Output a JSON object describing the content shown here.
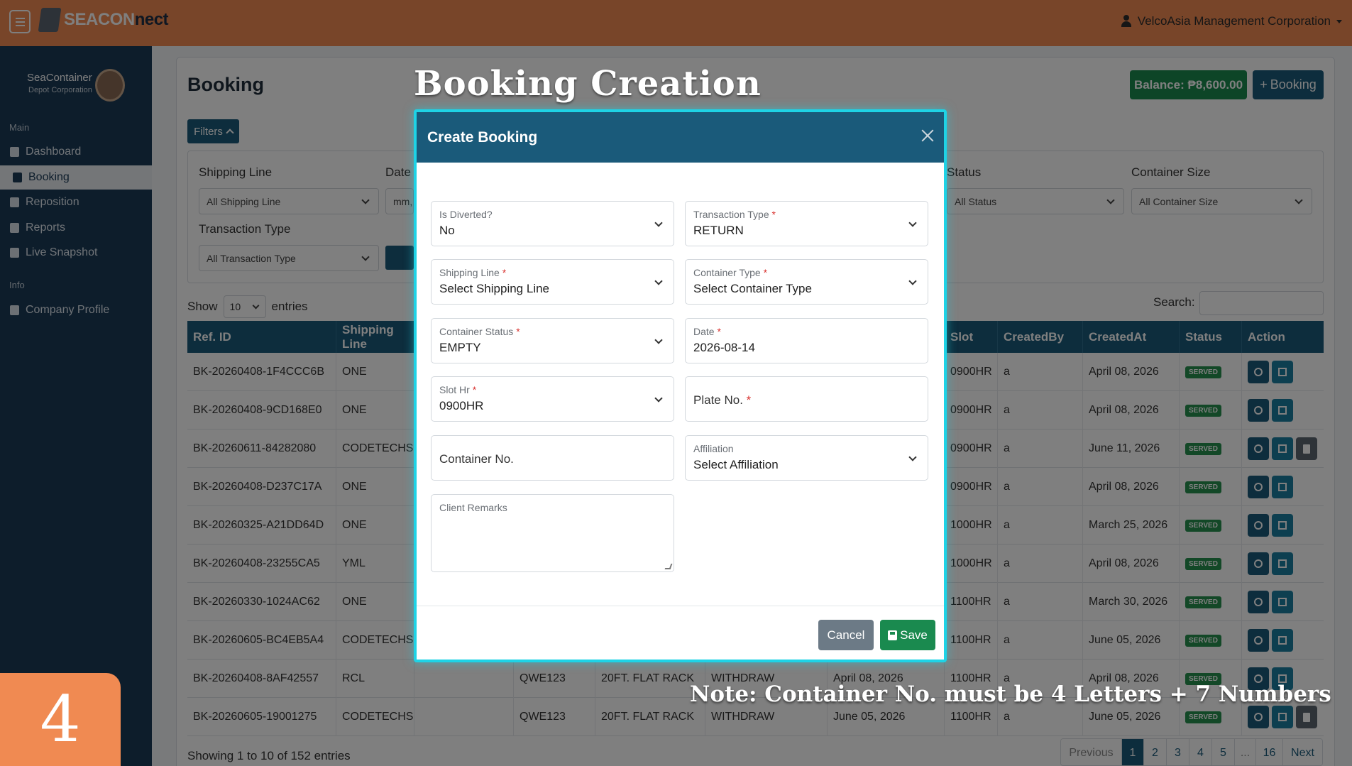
{
  "topbar": {
    "logo_text_a": "SEACON",
    "logo_text_b": "nect",
    "user_name": "VelcoAsia Management Corporation"
  },
  "sidebar": {
    "brand_name": "SeaContainer",
    "brand_sub": "Depot Corporation",
    "section_main": "Main",
    "section_info": "Info",
    "items": [
      {
        "label": "Dashboard",
        "icon": "bar-chart-icon"
      },
      {
        "label": "Booking",
        "icon": "list-icon"
      },
      {
        "label": "Reposition",
        "icon": "reposition-icon"
      },
      {
        "label": "Reports",
        "icon": "report-icon"
      },
      {
        "label": "Live Snapshot",
        "icon": "camera-icon"
      },
      {
        "label": "Company Profile",
        "icon": "user-icon"
      }
    ]
  },
  "page": {
    "title": "Booking",
    "balance": "Balance: ₱8,600.00",
    "new_booking": "Booking",
    "filters_btn": "Filters"
  },
  "filters": {
    "shipping_line_label": "Shipping Line",
    "shipping_line_value": "All Shipping Line",
    "date_label": "Date",
    "date_value": "mm,",
    "transaction_type_label": "Transaction Type",
    "transaction_type_value": "All Transaction Type",
    "status_label": "Status",
    "status_value": "All Status",
    "container_size_label": "Container Size",
    "container_size_value": "All Container Size"
  },
  "table_controls": {
    "show": "Show",
    "entries_value": "10",
    "entries": "entries",
    "search_label": "Search:"
  },
  "table": {
    "headers": [
      "Ref. ID",
      "Shipping Line",
      "Slot",
      "CreatedBy",
      "CreatedAt",
      "Status",
      "Action"
    ],
    "rows": [
      {
        "ref": "BK-20260408-1F4CCC6B",
        "line": "ONE",
        "plate": "",
        "size": "",
        "type": "",
        "date": "",
        "slot": "0900HR",
        "by": "a",
        "at": "April 08, 2026",
        "status": "SERVED",
        "doc": false
      },
      {
        "ref": "BK-20260408-9CD168E0",
        "line": "ONE",
        "plate": "",
        "size": "",
        "type": "",
        "date": "",
        "slot": "0900HR",
        "by": "a",
        "at": "April 08, 2026",
        "status": "SERVED",
        "doc": false
      },
      {
        "ref": "BK-20260611-84282080",
        "line": "CODETECHS",
        "plate": "",
        "size": "",
        "type": "",
        "date": "",
        "slot": "0900HR",
        "by": "a",
        "at": "June 11, 2026",
        "status": "SERVED",
        "doc": true
      },
      {
        "ref": "BK-20260408-D237C17A",
        "line": "ONE",
        "plate": "",
        "size": "",
        "type": "",
        "date": "",
        "slot": "0900HR",
        "by": "a",
        "at": "April 08, 2026",
        "status": "SERVED",
        "doc": false
      },
      {
        "ref": "BK-20260325-A21DD64D",
        "line": "ONE",
        "plate": "",
        "size": "",
        "type": "",
        "date": "",
        "slot": "1000HR",
        "by": "a",
        "at": "March 25, 2026",
        "status": "SERVED",
        "doc": false
      },
      {
        "ref": "BK-20260408-23255CA5",
        "line": "YML",
        "plate": "",
        "size": "",
        "type": "",
        "date": "",
        "slot": "1000HR",
        "by": "a",
        "at": "April 08, 2026",
        "status": "SERVED",
        "doc": false
      },
      {
        "ref": "BK-20260330-1024AC62",
        "line": "ONE",
        "plate": "",
        "size": "",
        "type": "",
        "date": "",
        "slot": "1100HR",
        "by": "a",
        "at": "March 30, 2026",
        "status": "SERVED",
        "doc": false
      },
      {
        "ref": "BK-20260605-BC4EB5A4",
        "line": "CODETECHS",
        "plate": "",
        "size": "",
        "type": "",
        "date": "",
        "slot": "1100HR",
        "by": "a",
        "at": "June 05, 2026",
        "status": "SERVED",
        "doc": false
      },
      {
        "ref": "BK-20260408-8AF42557",
        "line": "RCL",
        "plate": "QWE123",
        "size": "20FT. FLAT RACK",
        "type": "WITHDRAW",
        "date": "April 08, 2026",
        "slot": "1100HR",
        "by": "a",
        "at": "April 08, 2026",
        "status": "SERVED",
        "doc": false
      },
      {
        "ref": "BK-20260605-19001275",
        "line": "CODETECHS",
        "plate": "QWE123",
        "size": "20FT. FLAT RACK",
        "type": "WITHDRAW",
        "date": "June 05, 2026",
        "slot": "1100HR",
        "by": "a",
        "at": "June 05, 2026",
        "status": "SERVED",
        "doc": true
      }
    ]
  },
  "footer": {
    "info": "Showing 1 to 10 of 152 entries",
    "previous": "Previous",
    "pages": [
      "1",
      "2",
      "3",
      "4",
      "5",
      "...",
      "16"
    ],
    "next": "Next"
  },
  "modal": {
    "title": "Create Booking",
    "is_diverted_label": "Is Diverted?",
    "is_diverted_value": "No",
    "transaction_type_label": "Transaction Type",
    "transaction_type_value": "RETURN",
    "shipping_line_label": "Shipping Line",
    "shipping_line_value": "Select Shipping Line",
    "container_type_label": "Container Type",
    "container_type_value": "Select Container Type",
    "container_status_label": "Container Status",
    "container_status_value": "EMPTY",
    "date_label": "Date",
    "date_value": "2026-08-14",
    "slot_hr_label": "Slot Hr",
    "slot_hr_value": "0900HR",
    "plate_no_placeholder": "Plate No.",
    "container_no_placeholder": "Container No.",
    "affiliation_label": "Affiliation",
    "affiliation_value": "Select Affiliation",
    "client_remarks_placeholder": "Client Remarks",
    "cancel": "Cancel",
    "save": "Save",
    "required_mark": "*"
  },
  "overlay": {
    "title": "Booking Creation",
    "note": "Note: Container No. must be 4 Letters + 7 Numbers",
    "step": "4"
  },
  "colors": {
    "topbar": "#f08a52",
    "sidebar": "#1b3a57",
    "primary": "#1a5a7a",
    "success": "#1a8a4f",
    "modal_border": "#1ed3e6"
  }
}
